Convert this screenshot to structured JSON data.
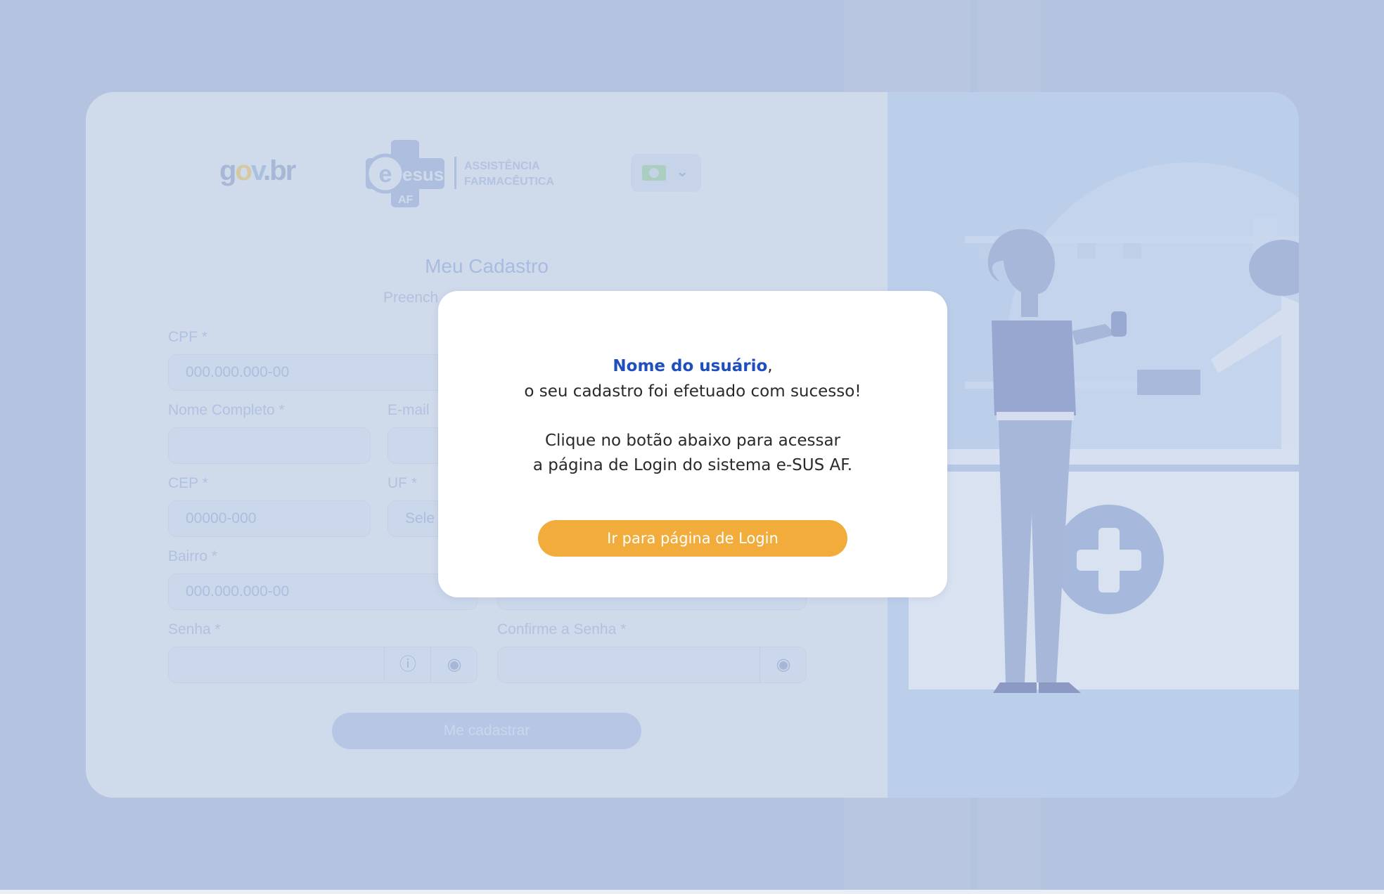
{
  "header": {
    "govbr_logo": "gov.br",
    "esus_logo": {
      "mark": "esus",
      "badge": "AF",
      "line1": "ASSISTÊNCIA",
      "line2": "FARMACÊUTICA"
    },
    "language_flag_icon": "brazil-flag-icon"
  },
  "form": {
    "title": "Meu Cadastro",
    "subtitle": "Preench",
    "fields": {
      "cpf": {
        "label": "CPF *",
        "placeholder": "000.000.000-00"
      },
      "nome": {
        "label": "Nome Completo *",
        "value": ""
      },
      "email": {
        "label": "E-mail",
        "value": ""
      },
      "cep": {
        "label": "CEP *",
        "placeholder": "00000-000"
      },
      "uf": {
        "label": "UF *",
        "value": "Sele"
      },
      "bairro": {
        "label": "Bairro *",
        "placeholder": "000.000.000-00"
      },
      "senha": {
        "label": "Senha *",
        "value": ""
      },
      "confirme": {
        "label": "Confirme a Senha *",
        "value": ""
      }
    },
    "submit_label": "Me cadastrar"
  },
  "modal": {
    "user_name": "Nome do usuário",
    "name_suffix": ",",
    "line1": "o seu cadastro foi efetuado com sucesso!",
    "line2": "Clique no botão abaixo para acessar",
    "line3": "a página de Login do sistema e-SUS AF.",
    "button_label": "Ir para página de Login"
  },
  "colors": {
    "overlay": "#b4c3e0",
    "modal_bg": "#ffffff",
    "accent_blue": "#1f4fbf",
    "button_orange": "#f2ac3c"
  }
}
